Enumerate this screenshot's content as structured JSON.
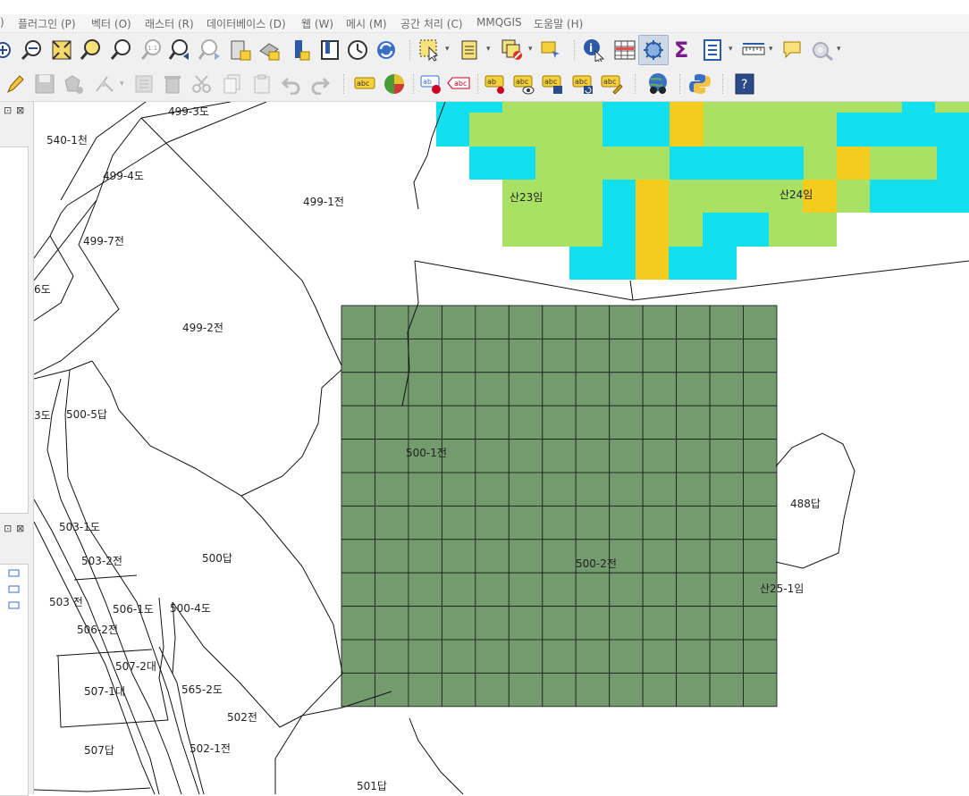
{
  "menu": {
    "items": [
      "플러그인 (P)",
      "벡터 (O)",
      "래스터 (R)",
      "데이터베이스 (D)",
      "웹 (W)",
      "메시 (M)",
      "공간 처리 (C)",
      "MMQGIS",
      "도움말 (H)"
    ],
    "partial_left": ")"
  },
  "toolbar_top": {
    "icons": [
      "zoom-in-icon",
      "zoom-out-icon",
      "zoom-full-icon",
      "zoom-to-selection-icon",
      "zoom-to-layer-icon",
      "zoom-native-icon",
      "zoom-last-icon",
      "zoom-next-icon",
      "new-bookmark-icon",
      "show-bookmarks-icon",
      "map-tips-icon",
      "temporal-controller-icon",
      "clock-icon",
      "refresh-icon",
      "select-features-icon",
      "select-by-value-icon",
      "deselect-icon",
      "select-by-expression-icon",
      "identify-icon",
      "open-attribute-table-icon",
      "processing-toolbox-icon",
      "statistics-sigma-icon",
      "field-calculator-icon",
      "measure-icon",
      "annotation-icon",
      "plugins-gear-icon"
    ],
    "sigma_label": "Σ"
  },
  "toolbar_digitize": {
    "icons": [
      "toggle-editing-pencil-icon",
      "save-edits-icon",
      "add-feature-icon",
      "vertex-tool-icon",
      "modify-attributes-icon",
      "delete-selected-icon",
      "cut-features-icon",
      "copy-features-icon",
      "paste-features-icon",
      "undo-icon",
      "redo-icon",
      "label-abc-icon",
      "layer-styling-icon",
      "pin-label-icon",
      "highlight-label-icon",
      "move-label-icon",
      "show-hide-label-icon",
      "change-label-icon",
      "rotate-label-icon",
      "label-properties-icon",
      "globe-binoculars-icon",
      "python-console-icon",
      "help-icon"
    ],
    "abc_text": "abc",
    "help_text": "?"
  },
  "panel": {
    "dock_buttons": [
      "⊡",
      "⊠"
    ]
  },
  "map": {
    "parcel_labels": [
      "499-3도",
      "540-1천",
      "499-4도",
      "499-1전",
      "499-7전",
      "6도",
      "499-2전",
      "3도",
      "500-5답",
      "500-1전",
      "503-1도",
      "503-2전",
      "500답",
      "503 전",
      "506-1도",
      "500-4도",
      "506-2전",
      "507-2대",
      "507-1대",
      "565-2도",
      "502전",
      "507답",
      "502-1전",
      "501답",
      "500-2전",
      "488답",
      "산25-1임",
      "산23임",
      "산24임"
    ],
    "colors": {
      "green_grid": "#739b6e",
      "raster_cyan": "#13e0ee",
      "raster_lime": "#a8e163",
      "raster_yellow": "#f4cc1d"
    }
  }
}
